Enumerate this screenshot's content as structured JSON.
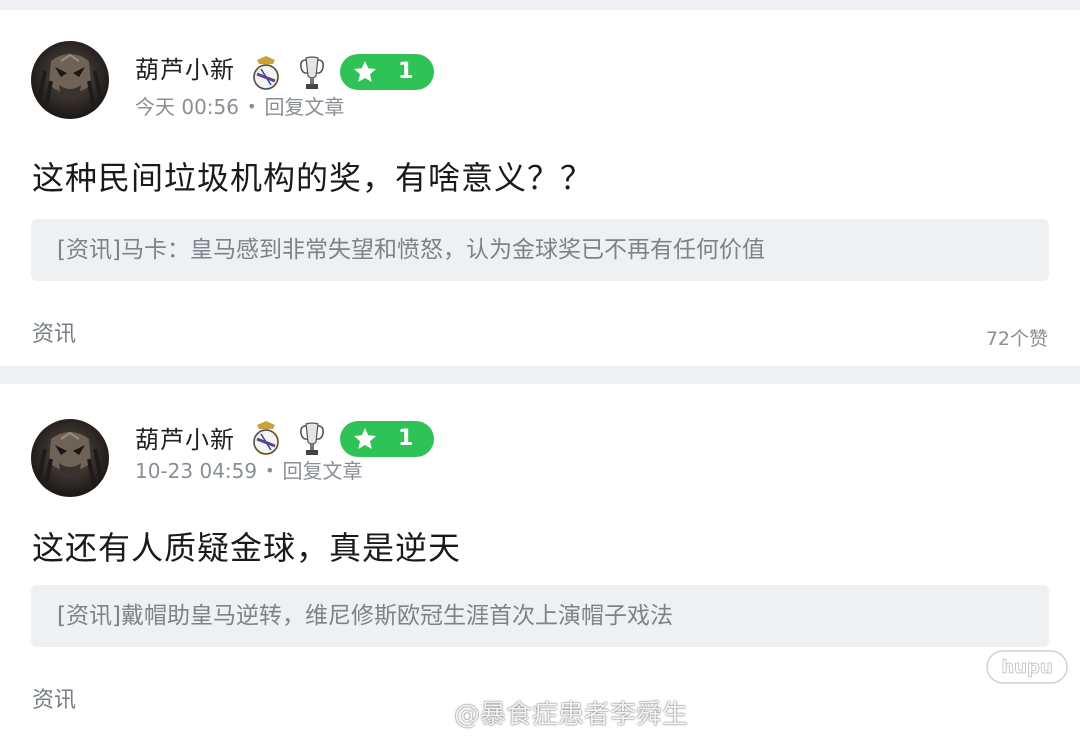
{
  "replies": [
    {
      "username": "葫芦小新",
      "level": "1",
      "time": "今天 00:56",
      "dot": "•",
      "action": "回复文章",
      "comment": "这种民间垃圾机构的奖，有啥意义？？",
      "quote": "[资讯]马卡：皇马感到非常失望和愤怒，认为金球奖已不再有任何价值",
      "tag": "资讯",
      "likes": "72个赞"
    },
    {
      "username": "葫芦小新",
      "level": "1",
      "time": "10-23 04:59",
      "dot": "•",
      "action": "回复文章",
      "comment": "这还有人质疑金球，真是逆天",
      "quote": "[资讯]戴帽助皇马逆转，维尼修斯欧冠生涯首次上演帽子戏法",
      "tag": "资讯"
    }
  ],
  "watermarks": {
    "hupu": "hupu",
    "weibo": "@暴食症患者李舜生"
  },
  "colors": {
    "accent_green": "#2fc257",
    "page_background": "#eef0f3",
    "quote_background": "#eef0f2"
  }
}
